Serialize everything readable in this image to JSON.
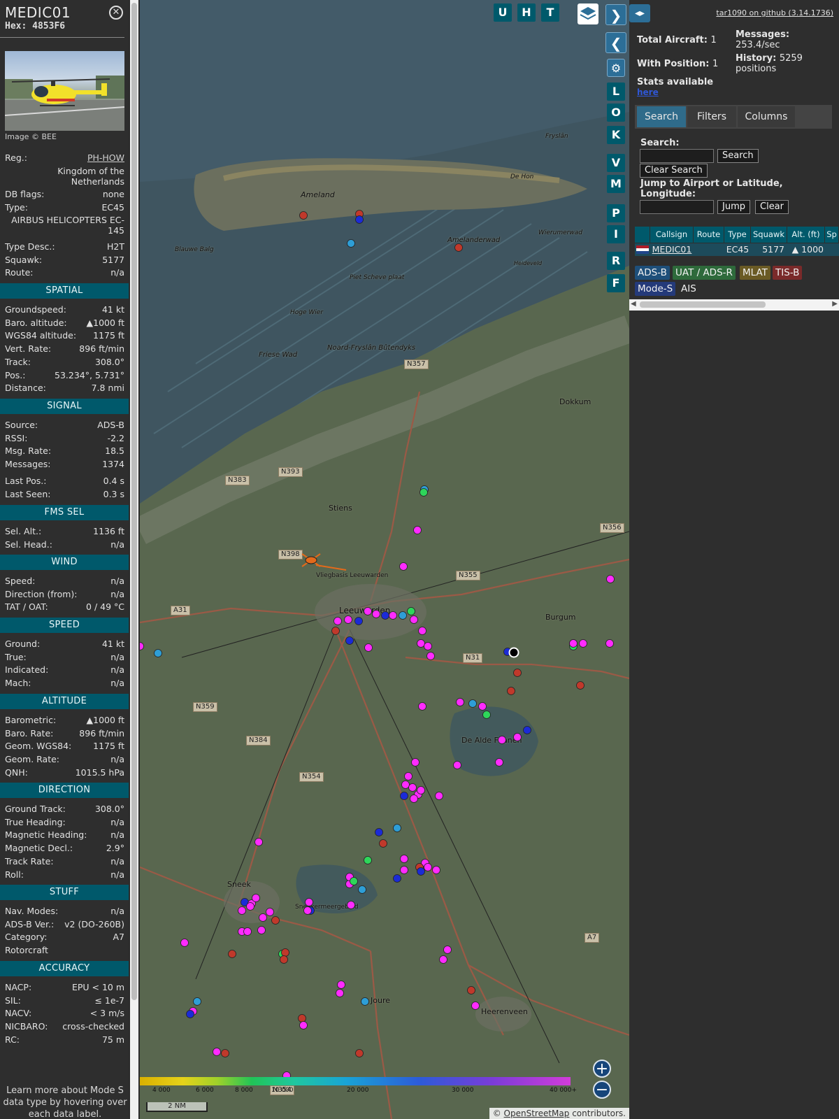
{
  "info": {
    "callsign": "MEDIC01",
    "hex_label": "Hex:",
    "hex": "4853F6",
    "image_credit": "Image © BEE",
    "top_rows": [
      {
        "k": "Reg.:",
        "v": "PH-HOW"
      },
      {
        "k": "",
        "v": "Kingdom of the"
      },
      {
        "k": "",
        "v": "Netherlands"
      },
      {
        "k": "DB flags:",
        "v": "none"
      },
      {
        "k": "Type:",
        "v": "EC45"
      },
      {
        "k": "",
        "v": "AIRBUS HELICOPTERS EC-"
      },
      {
        "k": "",
        "v": "145"
      },
      {
        "k": "Type Desc.:",
        "v": "H2T"
      },
      {
        "k": "Squawk:",
        "v": "5177"
      },
      {
        "k": "Route:",
        "v": "n/a"
      }
    ],
    "sections": [
      {
        "title": "SPATIAL",
        "rows": [
          {
            "k": "Groundspeed:",
            "v": "41 kt"
          },
          {
            "k": "Baro. altitude:",
            "v": "▲1000 ft"
          },
          {
            "k": "WGS84 altitude:",
            "v": "1175 ft"
          },
          {
            "k": "Vert. Rate:",
            "v": "896 ft/min"
          },
          {
            "k": "Track:",
            "v": "308.0°"
          },
          {
            "k": "Pos.:",
            "v": "53.234°, 5.731°"
          },
          {
            "k": "Distance:",
            "v": "7.8 nmi"
          }
        ]
      },
      {
        "title": "SIGNAL",
        "rows": [
          {
            "k": "Source:",
            "v": "ADS-B"
          },
          {
            "k": "RSSI:",
            "v": "-2.2"
          },
          {
            "k": "Msg. Rate:",
            "v": "18.5"
          },
          {
            "k": "Messages:",
            "v": "1374"
          },
          {
            "k": "Last Pos.:",
            "v": "0.4 s"
          },
          {
            "k": "Last Seen:",
            "v": "0.3 s"
          }
        ]
      },
      {
        "title": "FMS SEL",
        "rows": [
          {
            "k": "Sel. Alt.:",
            "v": "1136 ft"
          },
          {
            "k": "Sel. Head.:",
            "v": "n/a"
          }
        ]
      },
      {
        "title": "WIND",
        "rows": [
          {
            "k": "Speed:",
            "v": "n/a"
          },
          {
            "k": "Direction (from):",
            "v": "n/a"
          },
          {
            "k": "TAT / OAT:",
            "v": "0 / 49 °C"
          }
        ]
      },
      {
        "title": "SPEED",
        "rows": [
          {
            "k": "Ground:",
            "v": "41 kt"
          },
          {
            "k": "True:",
            "v": "n/a"
          },
          {
            "k": "Indicated:",
            "v": "n/a"
          },
          {
            "k": "Mach:",
            "v": "n/a"
          }
        ]
      },
      {
        "title": "ALTITUDE",
        "rows": [
          {
            "k": "Barometric:",
            "v": "▲1000 ft"
          },
          {
            "k": "Baro. Rate:",
            "v": "896 ft/min"
          },
          {
            "k": "Geom. WGS84:",
            "v": "1175 ft"
          },
          {
            "k": "Geom. Rate:",
            "v": "n/a"
          },
          {
            "k": "QNH:",
            "v": "1015.5 hPa"
          }
        ]
      },
      {
        "title": "DIRECTION",
        "rows": [
          {
            "k": "Ground Track:",
            "v": "308.0°"
          },
          {
            "k": "True Heading:",
            "v": "n/a"
          },
          {
            "k": "Magnetic Heading:",
            "v": "n/a"
          },
          {
            "k": "Magnetic Decl.:",
            "v": "2.9°"
          },
          {
            "k": "Track Rate:",
            "v": "n/a"
          },
          {
            "k": "Roll:",
            "v": "n/a"
          }
        ]
      },
      {
        "title": "STUFF",
        "rows": [
          {
            "k": "Nav. Modes:",
            "v": "n/a"
          },
          {
            "k": "ADS-B Ver.:",
            "v": "v2 (DO-260B)"
          },
          {
            "k": "Category:",
            "v": "A7"
          },
          {
            "k": "Rotorcraft",
            "v": ""
          }
        ]
      },
      {
        "title": "ACCURACY",
        "rows": [
          {
            "k": "NACP:",
            "v": "EPU < 10 m"
          },
          {
            "k": "SIL:",
            "v": "≤ 1e-7"
          },
          {
            "k": "NACV:",
            "v": "< 3 m/s"
          },
          {
            "k": "NICBARO:",
            "v": "cross-checked"
          },
          {
            "k": "RC:",
            "v": "75 m"
          }
        ]
      }
    ],
    "learn_more": "Learn more about Mode S data type by hovering over each data label."
  },
  "map": {
    "toolbar_letters": [
      "U",
      "H",
      "T"
    ],
    "side_letters": [
      "L",
      "O",
      "K",
      "V",
      "M",
      "P",
      "I",
      "R",
      "F"
    ],
    "labels": [
      "Ameland",
      "Amelanderwad",
      "Wierumerwad",
      "Blauwe Balg",
      "Piet Scheve plaat",
      "Hoge Wier",
      "Friese Wad",
      "Noard-Fryslân Bûtendyks",
      "Dokkum",
      "Stiens",
      "Vliegbasis Leeuwarden",
      "Leeuwarden",
      "Burgum",
      "De Alde Feanen",
      "Sneek",
      "Sneekermeergebied",
      "Joure",
      "Heerenveen",
      "De Hon",
      "Fryslân",
      "Heideveld"
    ],
    "roads": [
      "N357",
      "N393",
      "N383",
      "N398",
      "N355",
      "N356",
      "A31",
      "N31",
      "N359",
      "N384",
      "N354",
      "A7",
      "N354"
    ],
    "legend_ticks": [
      "4 000",
      "6 000",
      "8 000",
      "10 000",
      "20 000",
      "30 000",
      "40 000+"
    ],
    "scale": "2 NM",
    "attribution_prefix": "© ",
    "attribution_link": "OpenStreetMap",
    "attribution_suffix": " contributors."
  },
  "sidebar": {
    "github": "tar1090 on github (3.14.1736)",
    "total_aircraft_label": "Total Aircraft:",
    "total_aircraft": "1",
    "with_position_label": "With Position:",
    "with_position": "1",
    "messages_label": "Messages:",
    "messages": "253.4/sec",
    "history_label": "History:",
    "history": "5259 positions",
    "stats_label": "Stats available",
    "stats_link": "here",
    "tabs": [
      "Search",
      "Filters",
      "Columns"
    ],
    "search_label": "Search:",
    "search_button": "Search",
    "clear_search_button": "Clear Search",
    "jump_label": "Jump to Airport or Latitude, Longitude:",
    "jump_button": "Jump",
    "clear_button": "Clear",
    "table_headers": [
      "",
      "Callsign",
      "Route",
      "Type",
      "Squawk",
      "Alt. (ft)",
      "Sp"
    ],
    "table_row": {
      "callsign": "MEDIC01",
      "route": "",
      "type": "EC45",
      "squawk": "5177",
      "alt": "▲ 1000"
    },
    "sources": [
      {
        "label": "ADS-B",
        "color": "#1e4f7a"
      },
      {
        "label": "UAT / ADS-R",
        "color": "#2e6a3b"
      },
      {
        "label": "MLAT",
        "color": "#6a5a24"
      },
      {
        "label": "TIS-B",
        "color": "#7a2a2a"
      },
      {
        "label": "Mode-S",
        "color": "#243a7a"
      },
      {
        "label": "AIS",
        "color": "transparent"
      }
    ]
  }
}
